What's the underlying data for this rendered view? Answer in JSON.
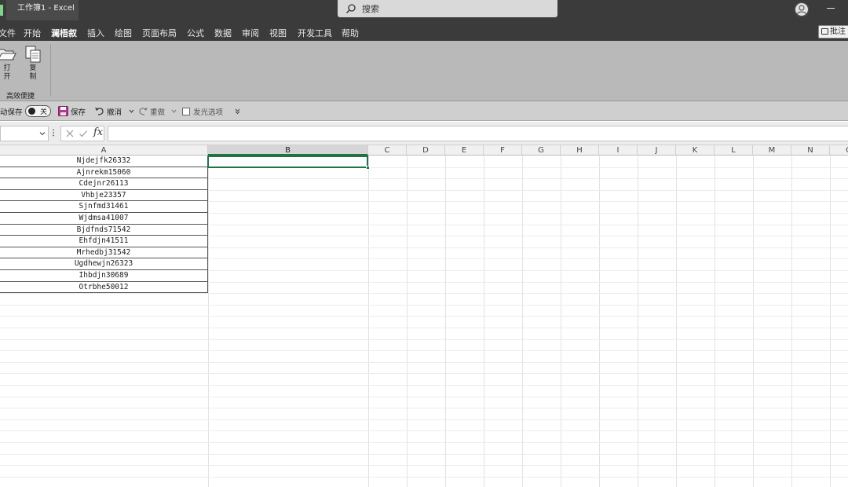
{
  "window": {
    "title": "工作簿1  -  Excel",
    "search_placeholder": "搜索"
  },
  "menu": {
    "items": [
      {
        "label": "文件"
      },
      {
        "label": "开始"
      },
      {
        "label": "澜梧叙"
      },
      {
        "label": "插入"
      },
      {
        "label": "绘图"
      },
      {
        "label": "页面布局"
      },
      {
        "label": "公式"
      },
      {
        "label": "数据"
      },
      {
        "label": "审阅"
      },
      {
        "label": "视图"
      },
      {
        "label": "开发工具"
      },
      {
        "label": "帮助"
      }
    ],
    "active": "澜梧叙",
    "comment_label": "批注"
  },
  "ribbon": {
    "buttons": [
      {
        "label": "打开",
        "icon": "folder-open-icon"
      },
      {
        "label": "复制",
        "icon": "copy-icon"
      }
    ],
    "group_label": "高效便捷"
  },
  "qat": {
    "autosave_label": "动保存",
    "autosave_state": "关",
    "save_label": "保存",
    "undo_label": "撤消",
    "redo_label": "重做",
    "option_label": "发光选项"
  },
  "formula_bar": {
    "name_box": "",
    "fx_label": "fx",
    "formula": ""
  },
  "grid": {
    "columns": [
      "A",
      "B",
      "C",
      "D",
      "E",
      "F",
      "G",
      "H",
      "I",
      "J",
      "K",
      "L",
      "M",
      "N",
      "O"
    ],
    "selected_column": "B",
    "column_a_values": [
      "Njdejfk26332",
      "Ajnrekm15060",
      "Cdejnr26113",
      "Vhbje23357",
      "Sjnfmd31461",
      "Wjdmsa41007",
      "Bjdfnds71542",
      "Ehfdjn41511",
      "Mrhedbj31542",
      "Ugdhewjn26323",
      "Ihbdjn30689",
      "Otrbhe50012"
    ]
  },
  "colors": {
    "accent": "#217346",
    "titlebar": "#3b3b3b",
    "ribbon": "#b9b9b9"
  }
}
